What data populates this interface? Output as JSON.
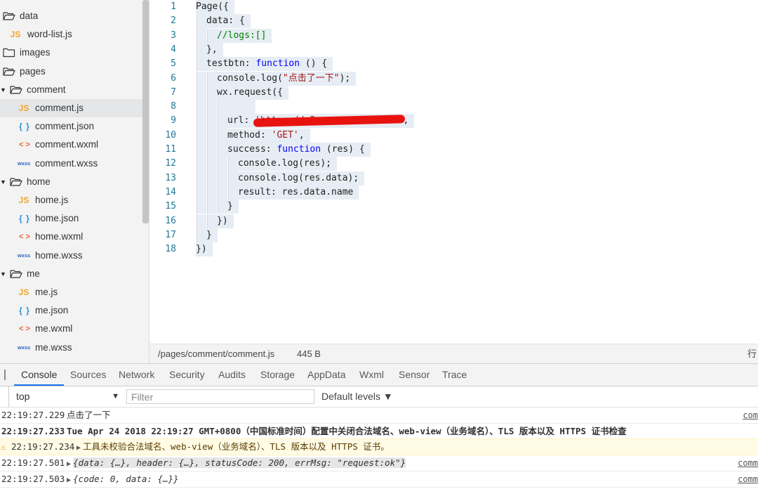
{
  "tree": {
    "items": [
      {
        "label": "data",
        "icon": "folder-open-icon",
        "type": "folder",
        "level": 0
      },
      {
        "label": "word-list.js",
        "icon": "js-file-icon",
        "icon_text": "JS",
        "type": "js",
        "level": 1
      },
      {
        "label": "images",
        "icon": "folder-icon",
        "type": "folder",
        "level": 0
      },
      {
        "label": "pages",
        "icon": "folder-open-icon",
        "type": "folder",
        "level": 0
      },
      {
        "label": "comment",
        "icon": "folder-open-icon",
        "type": "folder",
        "level": 0,
        "arrow": "▼"
      },
      {
        "label": "comment.js",
        "icon": "js-file-icon",
        "icon_text": "JS",
        "type": "js",
        "level": 1,
        "selected": true
      },
      {
        "label": "comment.json",
        "icon": "json-file-icon",
        "icon_text": "{ }",
        "type": "json",
        "level": 1
      },
      {
        "label": "comment.wxml",
        "icon": "wxml-file-icon",
        "icon_text": "< >",
        "type": "wxml",
        "level": 1
      },
      {
        "label": "comment.wxss",
        "icon": "wxss-file-icon",
        "icon_text": "wxss",
        "type": "wxss",
        "level": 1
      },
      {
        "label": "home",
        "icon": "folder-open-icon",
        "type": "folder",
        "level": 0,
        "arrow": "▼"
      },
      {
        "label": "home.js",
        "icon": "js-file-icon",
        "icon_text": "JS",
        "type": "js",
        "level": 1
      },
      {
        "label": "home.json",
        "icon": "json-file-icon",
        "icon_text": "{ }",
        "type": "json",
        "level": 1
      },
      {
        "label": "home.wxml",
        "icon": "wxml-file-icon",
        "icon_text": "< >",
        "type": "wxml",
        "level": 1
      },
      {
        "label": "home.wxss",
        "icon": "wxss-file-icon",
        "icon_text": "wxss",
        "type": "wxss",
        "level": 1
      },
      {
        "label": "me",
        "icon": "folder-open-icon",
        "type": "folder",
        "level": 0,
        "arrow": "▼"
      },
      {
        "label": "me.js",
        "icon": "js-file-icon",
        "icon_text": "JS",
        "type": "js",
        "level": 1
      },
      {
        "label": "me.json",
        "icon": "json-file-icon",
        "icon_text": "{ }",
        "type": "json",
        "level": 1
      },
      {
        "label": "me.wxml",
        "icon": "wxml-file-icon",
        "icon_text": "< >",
        "type": "wxml",
        "level": 1
      },
      {
        "label": "me.wxss",
        "icon": "wxss-file-icon",
        "icon_text": "wxss",
        "type": "wxss",
        "level": 1
      }
    ]
  },
  "editor": {
    "lines": [
      {
        "n": "1",
        "indent": 0,
        "tokens": [
          [
            "",
            "Page({"
          ]
        ]
      },
      {
        "n": "2",
        "indent": 1,
        "tokens": [
          [
            "",
            "data: {"
          ]
        ]
      },
      {
        "n": "3",
        "indent": 2,
        "tokens": [
          [
            "cmt",
            "//logs:[]"
          ]
        ]
      },
      {
        "n": "4",
        "indent": 1,
        "tokens": [
          [
            "",
            "},"
          ]
        ]
      },
      {
        "n": "5",
        "indent": 1,
        "tokens": [
          [
            "",
            "testbtn: "
          ],
          [
            "kw",
            "function"
          ],
          [
            "",
            " () {"
          ]
        ]
      },
      {
        "n": "6",
        "indent": 2,
        "tokens": [
          [
            "",
            "console.log("
          ],
          [
            "str",
            "\"点击了一下\""
          ],
          [
            "",
            ");"
          ]
        ]
      },
      {
        "n": "7",
        "indent": 2,
        "tokens": [
          [
            "",
            "wx.request({"
          ]
        ]
      },
      {
        "n": "8",
        "indent": 3,
        "tokens": [
          [
            "",
            ""
          ]
        ]
      },
      {
        "n": "9",
        "indent": 3,
        "tokens": [
          [
            "",
            "url: "
          ],
          [
            "str",
            "'https://p3amg..........ia'"
          ],
          [
            "",
            ","
          ]
        ]
      },
      {
        "n": "10",
        "indent": 3,
        "tokens": [
          [
            "",
            "method: "
          ],
          [
            "str",
            "'GET'"
          ],
          [
            "",
            ","
          ]
        ]
      },
      {
        "n": "11",
        "indent": 3,
        "tokens": [
          [
            "",
            "success: "
          ],
          [
            "kw",
            "function"
          ],
          [
            "",
            " (res) {"
          ]
        ]
      },
      {
        "n": "12",
        "indent": 4,
        "tokens": [
          [
            "",
            "console.log(res);"
          ]
        ]
      },
      {
        "n": "13",
        "indent": 4,
        "tokens": [
          [
            "",
            "console.log(res.data);"
          ]
        ]
      },
      {
        "n": "14",
        "indent": 4,
        "tokens": [
          [
            "",
            "result: res.data.name"
          ]
        ]
      },
      {
        "n": "15",
        "indent": 3,
        "tokens": [
          [
            "",
            "}"
          ]
        ]
      },
      {
        "n": "16",
        "indent": 2,
        "tokens": [
          [
            "",
            "})"
          ]
        ]
      },
      {
        "n": "17",
        "indent": 1,
        "tokens": [
          [
            "",
            "}"
          ]
        ]
      },
      {
        "n": "18",
        "indent": 0,
        "tokens": [
          [
            "",
            "})"
          ]
        ]
      }
    ]
  },
  "status": {
    "path": "/pages/comment/comment.js",
    "size": "445 B",
    "right": "行"
  },
  "devtools": {
    "tabs": [
      "Console",
      "Sources",
      "Network",
      "Security",
      "Audits",
      "Storage",
      "AppData",
      "Wxml",
      "Sensor",
      "Trace"
    ],
    "active_tab": "Console",
    "context": "top",
    "filter_placeholder": "Filter",
    "levels": "Default levels ▼"
  },
  "logs": [
    {
      "ts": "22:19:27.229",
      "msg": "点击了一下",
      "src": "com",
      "kind": "plain"
    },
    {
      "ts": "22:19:27.233",
      "msg": "Tue Apr 24 2018 22:19:27 GMT+0800（中国标准时间）配置中关闭合法域名、web-view（业务域名）、TLS 版本以及 HTTPS 证书检查",
      "src": "",
      "kind": "bold"
    },
    {
      "ts": "22:19:27.234",
      "msg": "工具未校验合法域名、web-view（业务域名）、TLS 版本以及 HTTPS 证书。",
      "src": "",
      "kind": "warn"
    },
    {
      "ts": "22:19:27.501",
      "msg": "{data: {…}, header: {…}, statusCode: 200, errMsg: \"request:ok\"}",
      "src": "comm",
      "kind": "obj"
    },
    {
      "ts": "22:19:27.503",
      "msg": "{code: 0, data: {…}}",
      "src": "comm",
      "kind": "obj2"
    }
  ],
  "colors": {
    "keyword": "#0000ff",
    "string": "#a31515",
    "comment": "#008000",
    "line_number": "#237893",
    "warn_bg": "#fffbe5",
    "redaction": "#e8130f"
  }
}
